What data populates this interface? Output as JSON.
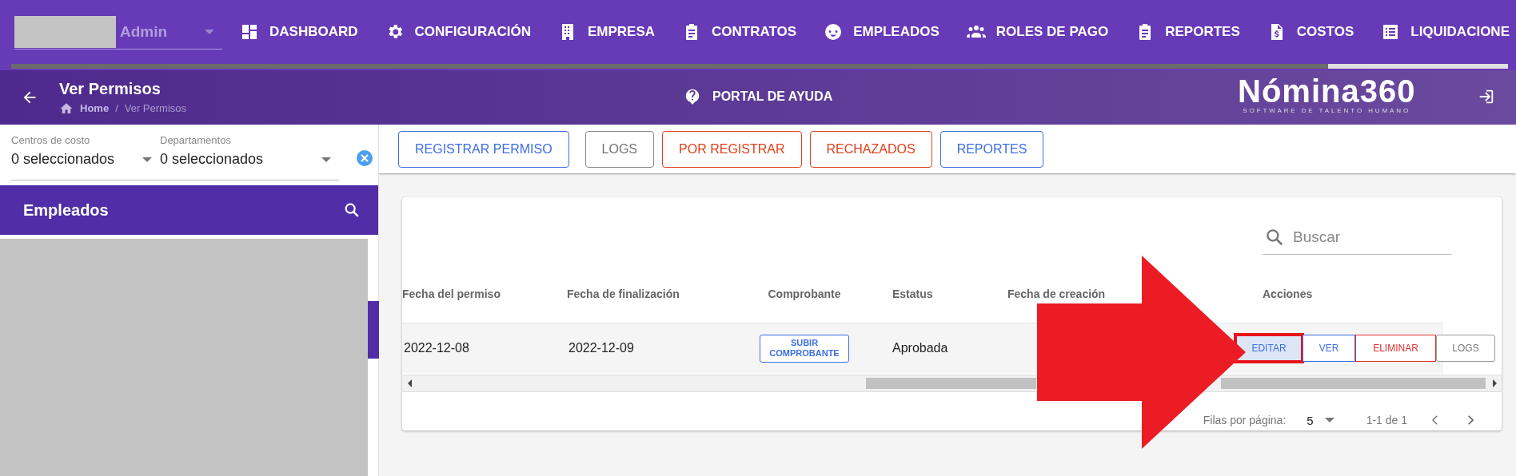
{
  "topbar": {
    "user": {
      "role": "Admin"
    },
    "nav": [
      {
        "label": "DASHBOARD"
      },
      {
        "label": "CONFIGURACIÓN"
      },
      {
        "label": "EMPRESA"
      },
      {
        "label": "CONTRATOS"
      },
      {
        "label": "EMPLEADOS"
      },
      {
        "label": "ROLES DE PAGO"
      },
      {
        "label": "REPORTES"
      },
      {
        "label": "COSTOS"
      },
      {
        "label": "LIQUIDACIONE"
      }
    ],
    "loading_bar": {
      "level": 0.88
    }
  },
  "header": {
    "title": "Ver Permisos",
    "breadcrumb": [
      "Home",
      "/",
      "Ver Permisos"
    ],
    "help": "PORTAL DE AYUDA",
    "logo": {
      "name": "Nómina360",
      "tagline": "SOFTWARE DE TALENTO HUMANO"
    }
  },
  "filters": [
    {
      "label": "Centros de costo",
      "value": "0 seleccionados"
    },
    {
      "label": "Departamentos",
      "value": "0 seleccionados"
    }
  ],
  "sidebar": {
    "title": "Empleados"
  },
  "toolbar": [
    {
      "label": "REGISTRAR PERMISO",
      "kind": "primary"
    },
    {
      "label": "LOGS",
      "kind": "neutral"
    },
    {
      "label": "POR REGISTRAR",
      "kind": "danger"
    },
    {
      "label": "RECHAZADOS",
      "kind": "danger"
    },
    {
      "label": "REPORTES",
      "kind": "primary"
    }
  ],
  "table": {
    "search": {
      "placeholder": "Buscar"
    },
    "columns": [
      "Fecha del permiso",
      "Fecha de finalización",
      "Comprobante",
      "Estatus",
      "Fecha de creación",
      "Acciones"
    ],
    "rows": [
      {
        "fecha_permiso": "2022-12-08",
        "fecha_fin": "2022-12-09",
        "comprobante": "SUBIR COMPROBANTE",
        "estatus": "Aprobada",
        "actions": [
          {
            "label": "EDITAR",
            "kind": "primary",
            "highlighted": true
          },
          {
            "label": "VER",
            "kind": "primary",
            "highlighted": false
          },
          {
            "label": "ELIMINAR",
            "kind": "danger",
            "highlighted": false
          },
          {
            "label": "LOGS",
            "kind": "neutral",
            "highlighted": false
          }
        ]
      }
    ],
    "pagination": {
      "label": "Filas por página:",
      "per_page": "5",
      "range": "1-1 de 1"
    }
  }
}
